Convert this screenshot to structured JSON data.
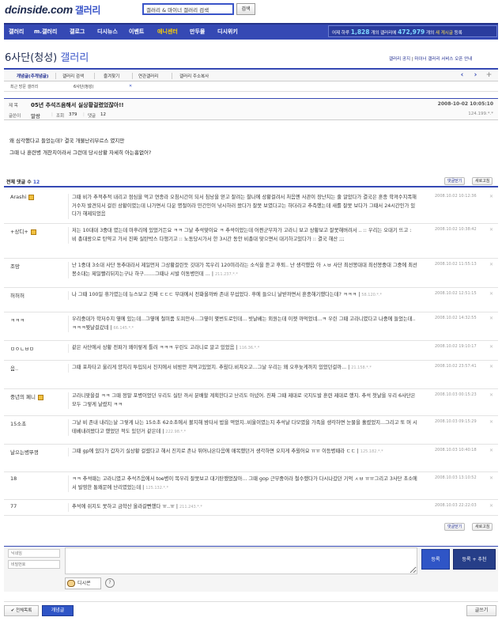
{
  "header": {
    "logo_text": "dcinside.com",
    "logo_gallery": "갤러리",
    "search_value": "갤러리 & 마이너 갤러리 검색",
    "search_button": "검색"
  },
  "nav": {
    "items": [
      "갤러리",
      "m.갤러리",
      "갤로그",
      "디시뉴스",
      "이벤트",
      "애니센터",
      "만두몰",
      "디시위키"
    ],
    "selected_index": 5,
    "stats": {
      "prefix": "어제 하루",
      "count1": "1,828",
      "mid": "개의 갤러리에",
      "count2": "472,979",
      "suffix_a": "개의",
      "suffix_b": "새 게시글",
      "suffix_c": "등록"
    }
  },
  "page": {
    "title_main": "6사단(청성)",
    "title_suffix": "갤러리",
    "links": [
      "갤러리 공지",
      "마이너 갤러리 서비스 오픈 안내"
    ]
  },
  "tabs": {
    "items": [
      "개념글(추개념글)",
      "갤러리 검색",
      "즐겨찾기",
      "연관갤러리",
      "갤러리 주소복사"
    ],
    "nav_buttons": [
      "‹",
      "›",
      "+"
    ]
  },
  "subtabs": {
    "items": [
      "최근 방문 갤러리",
      "6사단(청성)",
      "✕"
    ]
  },
  "post": {
    "label_title": "제 목",
    "title": "05년 추석즈음해서 실상황걸렸었잖아!!",
    "date": "2008-10-02 10:05:10",
    "label_author": "글쓴이",
    "author": "말랑",
    "label_views": "조회",
    "views": "379",
    "label_comments": "댓글",
    "comments": "12",
    "ip": "124.199.*.*",
    "body": [
      "왜 심각했다고 들었는데? 결국 개불난리부르스 였지만",
      "그때 나 훈련병 개찬치이라서 그런데 당시상황 자세히 아는흉없어?"
    ]
  },
  "comments_section": {
    "label": "전체 댓글 수",
    "count": "12",
    "buttons": [
      "댓글닫기",
      "새로고침"
    ],
    "items": [
      {
        "nick": "Arashi",
        "gicon": true,
        "text": "그때 비가 추적추적 내리고 점심을 먹고 연종라 오침시간이 되서 침낭을 얻고 잘려는 찰나에 상황걸려서 처음엔 사관이 장난치는 줄 알았다가 결국은 훈종 학져수지폭해 거수자 발견되서 걸린 상황이였는데 나가면서 다운 명절이라 민간인이 낚시하러 왔다가 잘못 보였다고는 하더라고 추측했는데 새를 잘못 보다가 그때서 24시간인가 있다가 해제되었음",
        "ip": "",
        "date": "2008.10.02 10:12:36",
        "del": "✕"
      },
      {
        "nick": "+상디+",
        "gicon": true,
        "text": "저는 10대대 3중대 였는데 마후리에 있었거든요 ㅋㅋ 그날 추석맞이요 ㅋ 추석이었는데 어쩐군무자가 고라니 보고 상황보고 잘못해버려서 .. :: 우리는 오대기 뜨고 : 비 총대랑으로 탄약고 가서 진짜 실탄박스 다챙기고 :: 노동당시가서 한 3시간 동안 비총대 맞으면서 대기하고있다가 :: 결국 해산 ;;;",
        "ip": "",
        "date": "2008.10.02 10:38:42",
        "del": "✕"
      },
      {
        "nick": "조망",
        "gicon": false,
        "text": "난 1중대 3소대 사단 동추대라서 제일먼저 그상황걸린듯 깃대가 목우리 120미리라는 소식을 듣고 후퇴.. 난 생각했음 아 ㅅㅂ 사단 최선봉대대 최선봉중대 그중에 최선봉소대는 제일빨리뒤지는구나 하구.......그때나 시발 이동병인데 ...",
        "ip": "211.237.*.*",
        "date": "2008.10.02 11:55:13",
        "del": "✕"
      },
      {
        "nick": "허허허",
        "gicon": false,
        "text": "나 그때 100일 휴가였는데 뉴스보고 진짜 ㄷㄷㄷ 부대에서 전화올까봐 존내 무섭었다. 후에 들으니 날받까면서 훈종해기했다는데? ㅋㅋㅋ",
        "ip": "58.120.*.*",
        "date": "2008.10.02 12:51:15",
        "del": "✕"
      },
      {
        "nick": "ㅋㅋㅋ",
        "gicon": false,
        "text": "우리중대가 학저수지 옆에 있는데...그옆에 철미품 도피안사...그옆이 몇번도로인데... 빗날베는 외원는데 이젯 까먹었네...ㅋ 우린 그때 고라니였다고 나중에 들었는데..ㅋㅋㅋ찢날걸갔네",
        "ip": "66.145.*.*",
        "date": "2008.10.02 14:32:55",
        "del": "✕"
      },
      {
        "nick": "ㅁㅇㄴㅂㅁ",
        "gicon": false,
        "text": "같은 사단에서 상황 전파가 왜이렇게 틀려 ㅋㅋㅋ 우린도 고라니로 알고 있었음",
        "ip": "116.36.*.*",
        "date": "2008.10.02 19:10:17",
        "del": "✕"
      },
      {
        "nick": "음..",
        "gicon": false,
        "text": "그때 포차타고 울리게 양치리 투입되서 진지에서 비밤만 쳐먹고있었지. 추웠다.비쳐오고...그날 우리는 왜 오후늦게까지 있었던걸까...",
        "ip": "21.158.*.*",
        "date": "2008.10.02 23:57:41",
        "del": "✕"
      },
      {
        "nick": "중년의 페니",
        "gicon": true,
        "text": "고라니맞을걸 ㅋㅋ 그때 정말 포병이었던 우리도 실탄 까서 분배할 계획한다고 난리도 아녔어. 진짜 그때 제대로 국지도발 훈련 제대로 했지. 추석 첫날을 우리 6사단은 모두 그렇게 날렸지 ㅋㅋ",
        "ip": "",
        "date": "2008.10.03 00:15:23",
        "del": "✕"
      },
      {
        "nick": "15소초",
        "gicon": false,
        "text": "그날 비 존내 내리는날 그렇게 나는 15소초 62소초에서 볼지해 밤타서 밥을 먹었지..비울이였는지 추석날 다모였을 가족을 생각하면 눈물을 흘렸었지...그리고 또 머 시테베내려왔다고 했었던 적도 있던거 같은데",
        "ip": "222.98.*.*",
        "date": "2008.10.03 09:15:29",
        "del": "✕"
      },
      {
        "nick": "날으는병뚜껑",
        "gicon": false,
        "text": "그때 gp에 있다가 갑자기 실상황 걸렸다고 해서 진지로 존나 뛰어나온다음에 매복했던거 생각하면 오지게 추웠어요 ㅠㅠ 이등병때라 ㄷㄷ",
        "ip": "125.182.*.*",
        "date": "2008.10.03 10:40:18",
        "del": "✕"
      },
      {
        "nick": "18",
        "gicon": false,
        "text": "ㅋㅋ 추석때는 고라니였고 추석즈음에서 toe병이 목우리 잘못보고 대기탄했었잖아... 그때 gop 근무중이라 철수했다가 다시나갔던 기억 ㅅㅂ ㅠㅠ그리고 3사단 초소에서 발영한 통왜문에 난리였었는데",
        "ip": "125.132.*.*",
        "date": "2008.10.03 13:10:52",
        "del": "✕"
      },
      {
        "nick": "77",
        "gicon": false,
        "text": "추석에 쉬지도 못하고 금학산 올라갈뻔했다 ㅠ..ㅠ",
        "ip": "211.243.*.*",
        "date": "2008.10.03 22:22:03",
        "del": "✕"
      }
    ]
  },
  "write": {
    "nick_placeholder": "닉네임",
    "pw_placeholder": "비밀번호",
    "register": "등록",
    "register_rec": "등록 + 추천",
    "dccon": "디시콘",
    "help": "?"
  },
  "bottom": {
    "all_button": "✔ 전체목록",
    "list_button": "개념글",
    "write_button": "글쓰기"
  },
  "colors": {
    "primary": "#3549b4",
    "accent_yellow": "#ffd200",
    "button_blue": "#2f55c6"
  }
}
